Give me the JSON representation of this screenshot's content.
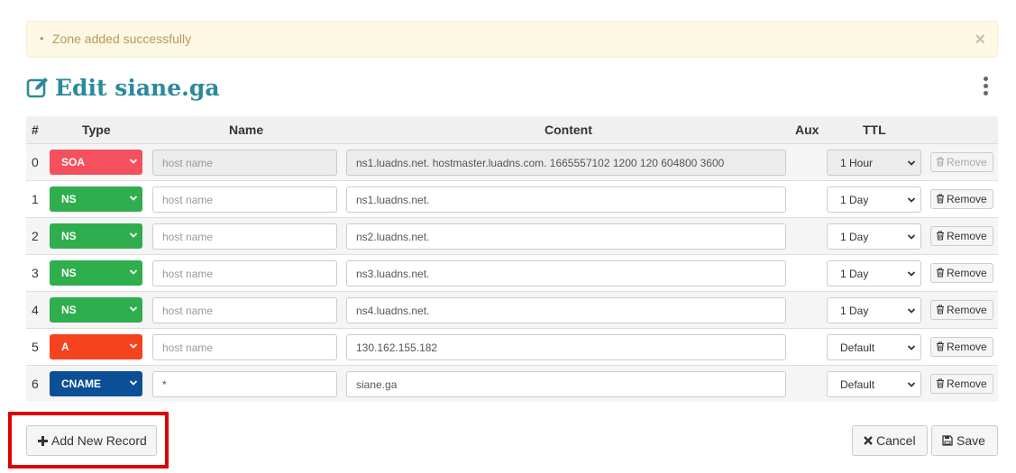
{
  "alert": {
    "bullet": "•",
    "message": "Zone added successfully",
    "close": "×"
  },
  "title": "Edit siane.ga",
  "table": {
    "headers": {
      "index": "#",
      "type": "Type",
      "name": "Name",
      "content": "Content",
      "aux": "Aux",
      "ttl": "TTL"
    },
    "rows": [
      {
        "idx": "0",
        "type": "SOA",
        "name": "",
        "name_placeholder": "host name",
        "content": "ns1.luadns.net. hostmaster.luadns.com. 1665557102 1200 120 604800 3600",
        "ttl": "1 Hour",
        "remove": "Remove",
        "locked": true
      },
      {
        "idx": "1",
        "type": "NS",
        "name": "",
        "name_placeholder": "host name",
        "content": "ns1.luadns.net.",
        "ttl": "1 Day",
        "remove": "Remove",
        "locked": false
      },
      {
        "idx": "2",
        "type": "NS",
        "name": "",
        "name_placeholder": "host name",
        "content": "ns2.luadns.net.",
        "ttl": "1 Day",
        "remove": "Remove",
        "locked": false
      },
      {
        "idx": "3",
        "type": "NS",
        "name": "",
        "name_placeholder": "host name",
        "content": "ns3.luadns.net.",
        "ttl": "1 Day",
        "remove": "Remove",
        "locked": false
      },
      {
        "idx": "4",
        "type": "NS",
        "name": "",
        "name_placeholder": "host name",
        "content": "ns4.luadns.net.",
        "ttl": "1 Day",
        "remove": "Remove",
        "locked": false
      },
      {
        "idx": "5",
        "type": "A",
        "name": "",
        "name_placeholder": "host name",
        "content": "130.162.155.182",
        "ttl": "Default",
        "remove": "Remove",
        "locked": false
      },
      {
        "idx": "6",
        "type": "CNAME",
        "name": "*",
        "name_placeholder": "host name",
        "content": "siane.ga",
        "ttl": "Default",
        "remove": "Remove",
        "locked": false
      }
    ]
  },
  "buttons": {
    "add": "Add New Record",
    "cancel": "Cancel",
    "save": "Save"
  },
  "colors": {
    "accent": "#2a8a9b",
    "soa": "#f4505d",
    "ns": "#2fae4e",
    "a": "#f5431f",
    "cname": "#0b4f96",
    "highlight": "#e00000"
  }
}
